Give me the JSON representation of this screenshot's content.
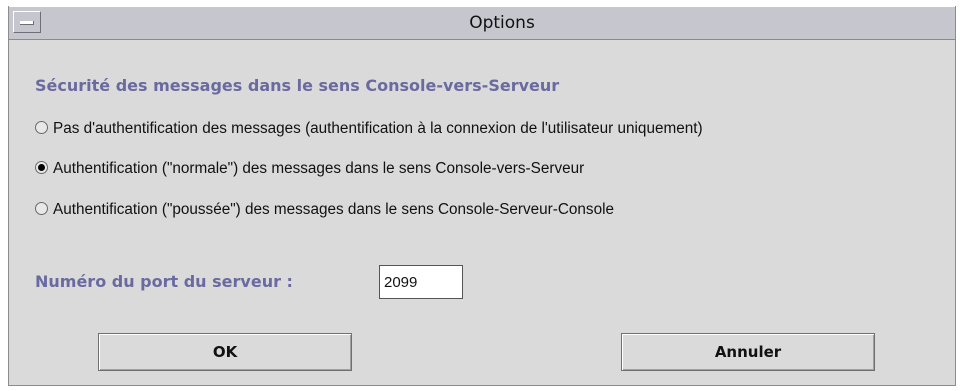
{
  "window": {
    "title": "Options"
  },
  "section": {
    "heading": "Sécurité des messages dans le sens Console-vers-Serveur"
  },
  "options": [
    {
      "label": "Pas d'authentification des messages (authentification à la connexion de l'utilisateur uniquement)",
      "selected": false
    },
    {
      "label": "Authentification (\"normale\") des messages dans le sens Console-vers-Serveur",
      "selected": true
    },
    {
      "label": "Authentification (\"poussée\") des messages dans le sens Console-Serveur-Console",
      "selected": false
    }
  ],
  "port": {
    "label": "Numéro du port du serveur :",
    "value": "2099"
  },
  "buttons": {
    "ok": "OK",
    "cancel": "Annuler"
  },
  "colors": {
    "title_bar": "#c6c6cf",
    "window_bg": "#dadada",
    "heading_text": "#6a6aa0"
  }
}
